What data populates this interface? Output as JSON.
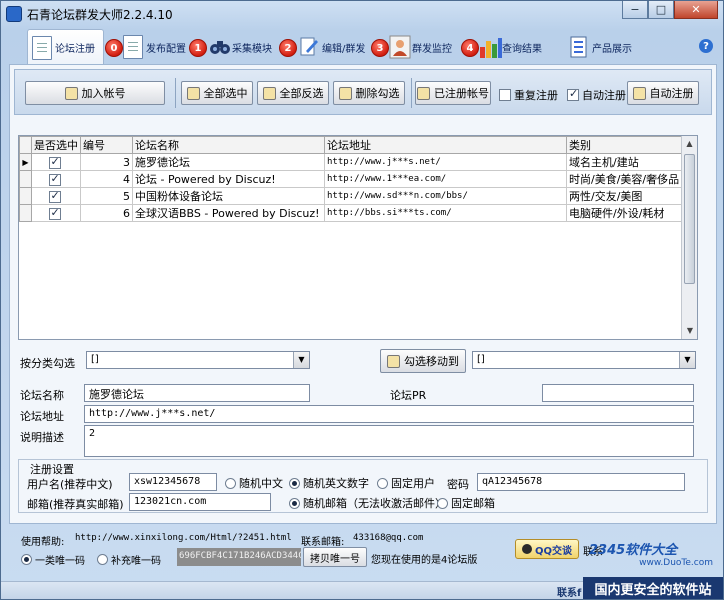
{
  "window": {
    "title": "石青论坛群发大师2.2.4.10",
    "min": "−",
    "max": "□",
    "close": "✕"
  },
  "nav": [
    {
      "label": "论坛注册",
      "badge": ""
    },
    {
      "label": "发布配置",
      "badge": "0"
    },
    {
      "label": "采集模块",
      "badge": "1"
    },
    {
      "label": "编辑/群发",
      "badge": "2"
    },
    {
      "label": "群发监控",
      "badge": "3"
    },
    {
      "label": "查询结果",
      "badge": "4"
    },
    {
      "label": "产品展示",
      "badge": ""
    }
  ],
  "help_icon": "?",
  "toolbar": {
    "add_account": "加入帐号",
    "select_all": "全部选中",
    "invert": "全部反选",
    "delete_checked": "删除勾选",
    "registered_accounts": "已注册帐号",
    "repeat_register": "重复注册",
    "auto_register_check": "自动注册",
    "auto_register_btn": "自动注册",
    "repeat_checked": false,
    "auto_checked": true
  },
  "table": {
    "headers": [
      "是否选中",
      "编号",
      "论坛名称",
      "论坛地址",
      "类别"
    ],
    "rows": [
      {
        "checked": true,
        "id": "3",
        "name": "施罗德论坛",
        "url": "http://www.j***s.net/",
        "category": "域名主机/建站"
      },
      {
        "checked": true,
        "id": "4",
        "name": "论坛 -  Powered by Discuz!",
        "url": "http://www.1***ea.com/",
        "category": "时尚/美食/美容/奢侈品"
      },
      {
        "checked": true,
        "id": "5",
        "name": "中国粉体设备论坛",
        "url": "http://www.sd***n.com/bbs/",
        "category": "两性/交友/美图"
      },
      {
        "checked": true,
        "id": "6",
        "name": " 全球汉语BBS  - Powered by Discuz!",
        "url": "http://bbs.si***ts.com/",
        "category": "电脑硬件/外设/耗材"
      }
    ]
  },
  "filter": {
    "label": "按分类勾选",
    "value1": "[]",
    "move_btn": "勾选移动到",
    "value2": "[]"
  },
  "detail": {
    "name_label": "论坛名称",
    "name_value": "施罗德论坛",
    "pr_label": "论坛PR",
    "pr_value": "",
    "url_label": "论坛地址",
    "url_value": "http://www.j***s.net/",
    "desc_label": "说明描述",
    "desc_value": "2"
  },
  "reg": {
    "group_title": "注册设置",
    "user_label": "用户名(推荐中文)",
    "user_value": "xsw12345678",
    "opt_random_cn": "随机中文",
    "opt_random_en": "随机英文数字",
    "opt_fixed_user": "固定用户",
    "pwd_label": "密码",
    "pwd_value": "qA12345678",
    "mail_label": "邮箱(推荐真实邮箱)",
    "mail_value": "123021cn.com",
    "opt_random_mail": "随机邮箱（无法收激活邮件）",
    "opt_fixed_mail": "固定邮箱"
  },
  "footer": {
    "help_label": "使用帮助:",
    "help_url": "http://www.xinxilong.com/Html/?2451.html",
    "contact_label": "联系邮箱:",
    "contact_email": "433168@qq.com",
    "opt_one": "一类唯一码",
    "opt_two": "补充唯一码",
    "machine_code": "696FCBF4C171B246ACD344C7C30",
    "copy_btn": "拷贝唯一号",
    "version_text": "您现在使用的是4论坛版",
    "qq_btn": "QQ交谈",
    "contact_short": "联系",
    "status_text": "联系f"
  },
  "watermark": {
    "logo": "2345软件大全",
    "site": "www.DuoTe.com",
    "slogan": "国内更安全的软件站"
  }
}
